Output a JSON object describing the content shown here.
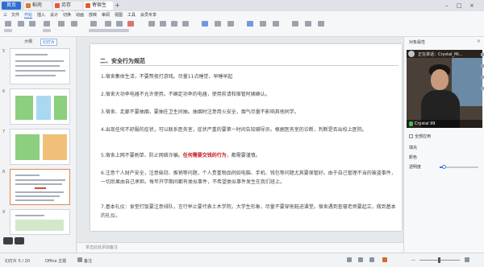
{
  "tabs": {
    "home": "首页",
    "tab1": "稻壳",
    "tab2": "另存2...ppt",
    "doc": "寄宿生pptx"
  },
  "menu": [
    "三",
    "文件",
    "开始",
    "插入",
    "设计",
    "切换",
    "动画",
    "放映",
    "审阅",
    "视图",
    "工具",
    "会员专享"
  ],
  "left_panel": {
    "tab_outline": "大纲",
    "tab_slides": "幻灯片",
    "slide_numbers": [
      "5",
      "6",
      "7",
      "8",
      "9"
    ]
  },
  "slide": {
    "title": "二、安全行为规范",
    "p1": "1.宿舍集体生活，不要熬夜打游戏。尽量11点睡觉，早睡早起",
    "p2": "2.宿舍大功率电器不允许使用。不确定功率的电器，使用前请和宿管阿姨确认。",
    "p3": "3.宿舍、走廊不要抽烟，要抽在卫生间抽。抽烟时注意用火安全，烟气尽量不影响其他同学。",
    "p4": "4.出现任何不舒服的症状，可以联系医务室，症状严重的要第一时间告知辅导员。根据医务室的诊断，判断是否出校上医院。",
    "p5_before": "5.宿舍上网不要刷单、防止网络诈骗。",
    "p5_highlight": "任何需要交钱的行为",
    "p5_after": "，都需要谨慎。",
    "p6": "6.注意个人财产安全，注意偷窃、推销等问题，个人贵重物品例如电脑、手机、钱包等问题尤其要保管好。由于自己管理不当的被盗事件，一切后果由自己承担。每年开学期间都有类似事件，不希望类似事件发生在我们班上。",
    "p7": "7.基本礼仪：食堂打饭要注意排队，言行举止要代表土木学院，大学生形象，尽量不要穿拖鞋进课堂。宿舍遇到查寝老师要起立，做到基本的礼仪。"
  },
  "notes_placeholder": "单击此处添加备注",
  "right_panel": {
    "title": "对象属性",
    "video_top": "正在讲话：Crystal_Mi...",
    "video_name": "Crystal 99",
    "option1": "全部应用",
    "option2": "透明度",
    "label_bg": "填充",
    "label_color": "颜色",
    "transparency": 0.1
  },
  "status": {
    "slide_info": "幻灯片 5 / 20",
    "theme": "Office 主题",
    "notes_btn": "备注",
    "zoom_text": "—"
  },
  "colors": {
    "accent": "#2f6fd1",
    "highlight": "#c8191c"
  }
}
